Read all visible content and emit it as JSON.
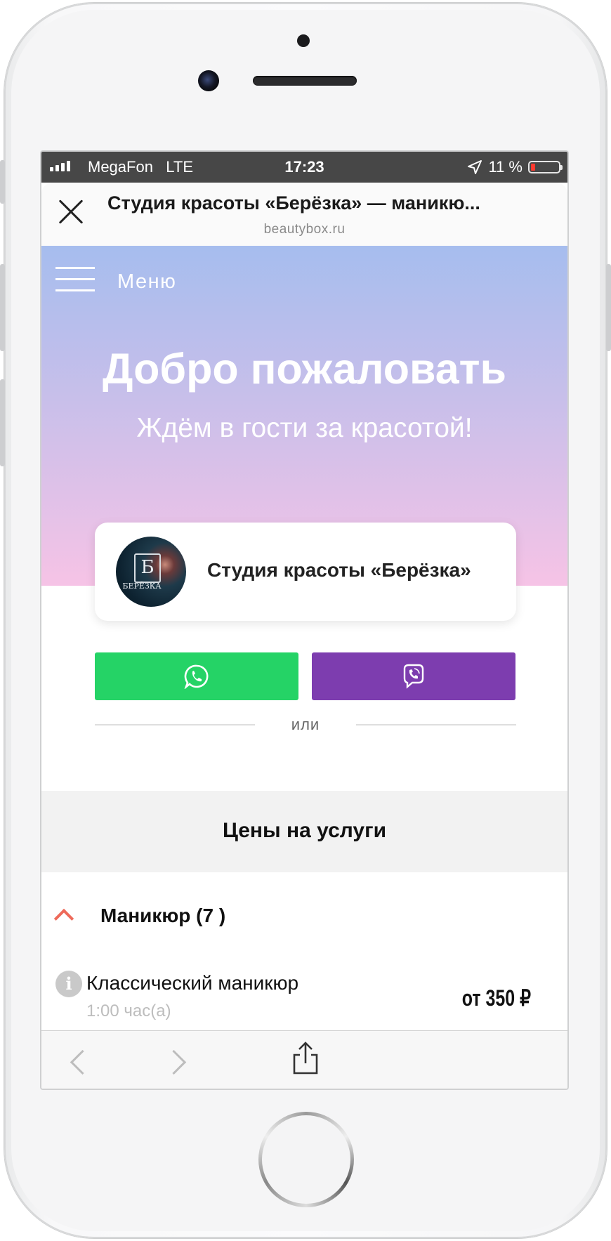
{
  "status_bar": {
    "carrier": "MegaFon",
    "network": "LTE",
    "time": "17:23",
    "battery": "11 %"
  },
  "sheet": {
    "title": "Студия красоты «Берёзка» — маникю...",
    "url": "beautybox.ru"
  },
  "hero": {
    "menu_label": "Меню",
    "title": "Добро пожаловать",
    "subtitle": "Ждём в гости за красотой!"
  },
  "salon": {
    "name": "Студия красоты «Берёзка»",
    "logo_letter": "Б",
    "logo_text": "БЕРЁЗКА"
  },
  "messengers": [
    {
      "name": "whatsapp-icon",
      "color": "#25d366"
    },
    {
      "name": "viber-icon",
      "color": "#7d3daf"
    }
  ],
  "divider_text": "или",
  "prices": {
    "heading": "Цены на услуги",
    "category": "Маникюр (7 )",
    "services": [
      {
        "name": "Классический маникюр",
        "duration": "1:00 час(а)",
        "price": "от 350 ₽"
      }
    ]
  },
  "colors": {
    "accent": "#ee6a5a",
    "whatsapp": "#25d366",
    "viber": "#7d3daf"
  }
}
